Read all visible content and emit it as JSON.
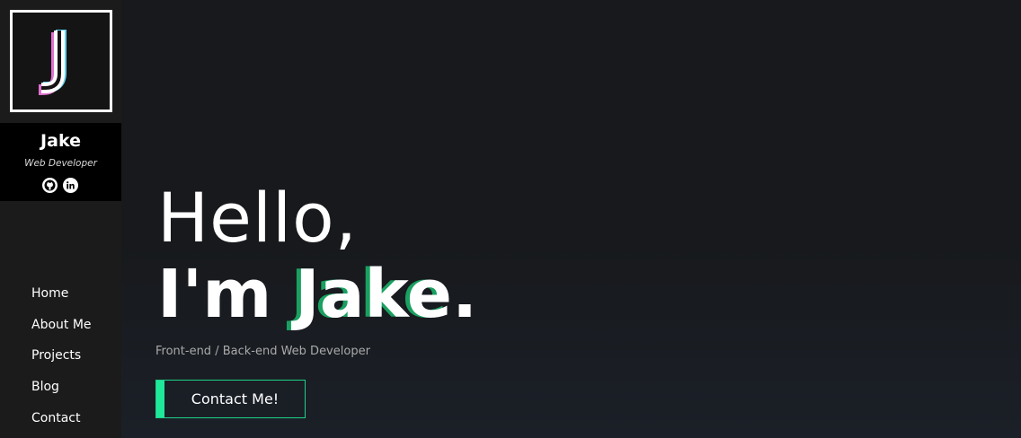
{
  "sidebar": {
    "logo_letter": "J",
    "profile": {
      "name": "Jake",
      "title": "Web Developer"
    },
    "socials": [
      {
        "icon": "github-icon"
      },
      {
        "icon": "linkedin-icon"
      }
    ],
    "nav": [
      {
        "label": "Home"
      },
      {
        "label": "About Me"
      },
      {
        "label": "Projects"
      },
      {
        "label": "Blog"
      },
      {
        "label": "Contact"
      }
    ]
  },
  "hero": {
    "greeting": "Hello,",
    "intro_prefix": "I'm ",
    "intro_name": "Jake",
    "intro_suffix": ".",
    "subtitle": "Front-end / Back-end Web Developer",
    "cta_label": "Contact Me!"
  },
  "colors": {
    "accent": "#1fe89a",
    "accent_dark": "#1aa060",
    "background": "#17191c",
    "sidebar": "#1b1b1b",
    "profile_bg": "#000000"
  }
}
